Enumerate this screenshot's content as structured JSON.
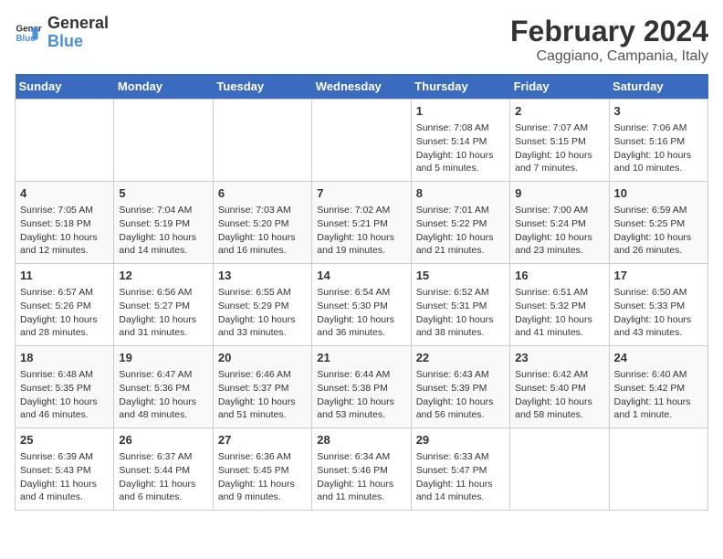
{
  "logo": {
    "line1": "General",
    "line2": "Blue"
  },
  "title": "February 2024",
  "subtitle": "Caggiano, Campania, Italy",
  "headers": [
    "Sunday",
    "Monday",
    "Tuesday",
    "Wednesday",
    "Thursday",
    "Friday",
    "Saturday"
  ],
  "weeks": [
    [
      {
        "day": "",
        "info": ""
      },
      {
        "day": "",
        "info": ""
      },
      {
        "day": "",
        "info": ""
      },
      {
        "day": "",
        "info": ""
      },
      {
        "day": "1",
        "info": "Sunrise: 7:08 AM\nSunset: 5:14 PM\nDaylight: 10 hours and 5 minutes."
      },
      {
        "day": "2",
        "info": "Sunrise: 7:07 AM\nSunset: 5:15 PM\nDaylight: 10 hours and 7 minutes."
      },
      {
        "day": "3",
        "info": "Sunrise: 7:06 AM\nSunset: 5:16 PM\nDaylight: 10 hours and 10 minutes."
      }
    ],
    [
      {
        "day": "4",
        "info": "Sunrise: 7:05 AM\nSunset: 5:18 PM\nDaylight: 10 hours and 12 minutes."
      },
      {
        "day": "5",
        "info": "Sunrise: 7:04 AM\nSunset: 5:19 PM\nDaylight: 10 hours and 14 minutes."
      },
      {
        "day": "6",
        "info": "Sunrise: 7:03 AM\nSunset: 5:20 PM\nDaylight: 10 hours and 16 minutes."
      },
      {
        "day": "7",
        "info": "Sunrise: 7:02 AM\nSunset: 5:21 PM\nDaylight: 10 hours and 19 minutes."
      },
      {
        "day": "8",
        "info": "Sunrise: 7:01 AM\nSunset: 5:22 PM\nDaylight: 10 hours and 21 minutes."
      },
      {
        "day": "9",
        "info": "Sunrise: 7:00 AM\nSunset: 5:24 PM\nDaylight: 10 hours and 23 minutes."
      },
      {
        "day": "10",
        "info": "Sunrise: 6:59 AM\nSunset: 5:25 PM\nDaylight: 10 hours and 26 minutes."
      }
    ],
    [
      {
        "day": "11",
        "info": "Sunrise: 6:57 AM\nSunset: 5:26 PM\nDaylight: 10 hours and 28 minutes."
      },
      {
        "day": "12",
        "info": "Sunrise: 6:56 AM\nSunset: 5:27 PM\nDaylight: 10 hours and 31 minutes."
      },
      {
        "day": "13",
        "info": "Sunrise: 6:55 AM\nSunset: 5:29 PM\nDaylight: 10 hours and 33 minutes."
      },
      {
        "day": "14",
        "info": "Sunrise: 6:54 AM\nSunset: 5:30 PM\nDaylight: 10 hours and 36 minutes."
      },
      {
        "day": "15",
        "info": "Sunrise: 6:52 AM\nSunset: 5:31 PM\nDaylight: 10 hours and 38 minutes."
      },
      {
        "day": "16",
        "info": "Sunrise: 6:51 AM\nSunset: 5:32 PM\nDaylight: 10 hours and 41 minutes."
      },
      {
        "day": "17",
        "info": "Sunrise: 6:50 AM\nSunset: 5:33 PM\nDaylight: 10 hours and 43 minutes."
      }
    ],
    [
      {
        "day": "18",
        "info": "Sunrise: 6:48 AM\nSunset: 5:35 PM\nDaylight: 10 hours and 46 minutes."
      },
      {
        "day": "19",
        "info": "Sunrise: 6:47 AM\nSunset: 5:36 PM\nDaylight: 10 hours and 48 minutes."
      },
      {
        "day": "20",
        "info": "Sunrise: 6:46 AM\nSunset: 5:37 PM\nDaylight: 10 hours and 51 minutes."
      },
      {
        "day": "21",
        "info": "Sunrise: 6:44 AM\nSunset: 5:38 PM\nDaylight: 10 hours and 53 minutes."
      },
      {
        "day": "22",
        "info": "Sunrise: 6:43 AM\nSunset: 5:39 PM\nDaylight: 10 hours and 56 minutes."
      },
      {
        "day": "23",
        "info": "Sunrise: 6:42 AM\nSunset: 5:40 PM\nDaylight: 10 hours and 58 minutes."
      },
      {
        "day": "24",
        "info": "Sunrise: 6:40 AM\nSunset: 5:42 PM\nDaylight: 11 hours and 1 minute."
      }
    ],
    [
      {
        "day": "25",
        "info": "Sunrise: 6:39 AM\nSunset: 5:43 PM\nDaylight: 11 hours and 4 minutes."
      },
      {
        "day": "26",
        "info": "Sunrise: 6:37 AM\nSunset: 5:44 PM\nDaylight: 11 hours and 6 minutes."
      },
      {
        "day": "27",
        "info": "Sunrise: 6:36 AM\nSunset: 5:45 PM\nDaylight: 11 hours and 9 minutes."
      },
      {
        "day": "28",
        "info": "Sunrise: 6:34 AM\nSunset: 5:46 PM\nDaylight: 11 hours and 11 minutes."
      },
      {
        "day": "29",
        "info": "Sunrise: 6:33 AM\nSunset: 5:47 PM\nDaylight: 11 hours and 14 minutes."
      },
      {
        "day": "",
        "info": ""
      },
      {
        "day": "",
        "info": ""
      }
    ]
  ]
}
